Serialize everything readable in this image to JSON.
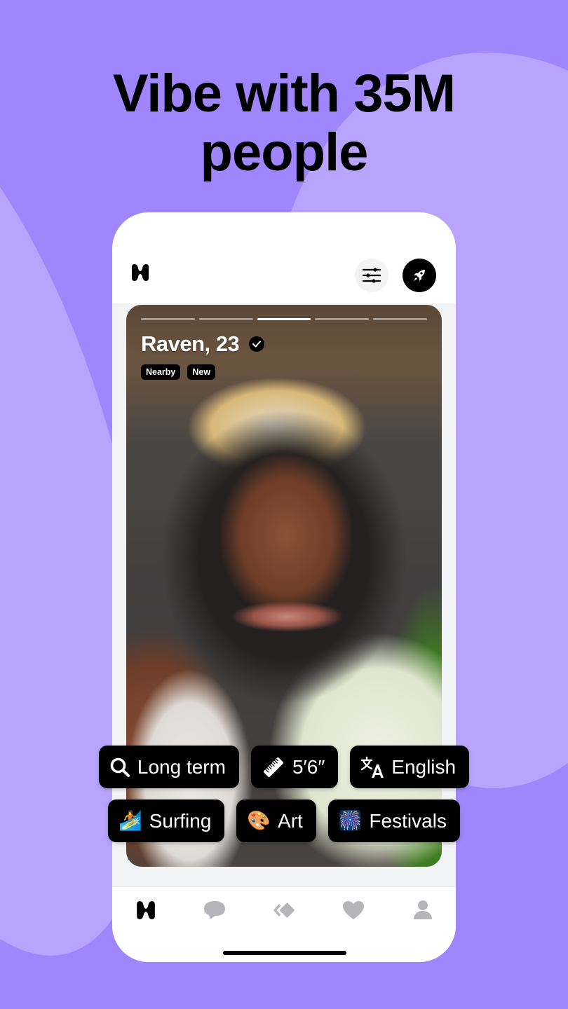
{
  "headline": {
    "line1": "Vibe with 35M",
    "line2": "people"
  },
  "colors": {
    "background": "#a086fc",
    "blob": "#b9a4fd",
    "chip_bg": "#000000",
    "tab_active": "#000000",
    "tab_inactive": "#b5b5b9"
  },
  "app": {
    "logo_icon": "hinge-logo-icon",
    "filter_icon": "sliders-icon",
    "boost_icon": "rocket-icon"
  },
  "profile": {
    "name_age": "Raven, 23",
    "verified_icon": "checkmark-icon",
    "photo_count": 5,
    "active_photo_index": 3,
    "badges": [
      "Nearby",
      "New"
    ]
  },
  "chips": {
    "row1": [
      {
        "icon": "search-icon",
        "label": "Long term"
      },
      {
        "icon": "ruler-icon",
        "label": "5′6″"
      },
      {
        "icon": "translate-icon",
        "label": "English"
      }
    ],
    "row2": [
      {
        "icon": "🏄",
        "icon_name": "surfer-icon",
        "label": "Surfing"
      },
      {
        "icon": "🎨",
        "icon_name": "palette-icon",
        "label": "Art"
      },
      {
        "icon": "🎆",
        "icon_name": "fireworks-icon",
        "label": "Festivals"
      }
    ]
  },
  "tabs": [
    {
      "name": "discover",
      "icon": "hinge-logo-icon",
      "active": true
    },
    {
      "name": "chats",
      "icon": "chat-bubble-icon",
      "active": false
    },
    {
      "name": "standouts",
      "icon": "diamond-chevron-icon",
      "active": false
    },
    {
      "name": "likes",
      "icon": "heart-icon",
      "active": false
    },
    {
      "name": "profile",
      "icon": "person-icon",
      "active": false
    }
  ]
}
